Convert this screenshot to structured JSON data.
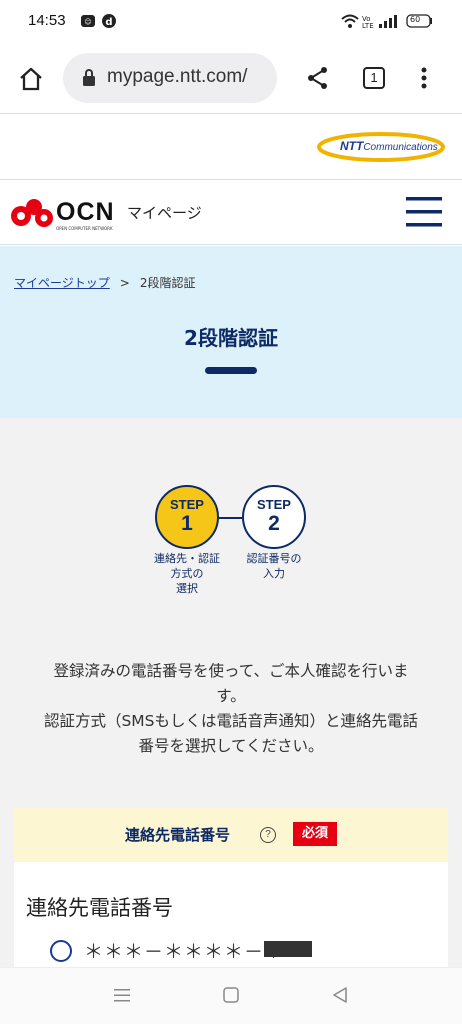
{
  "status_bar": {
    "time": "14:53",
    "battery": "60"
  },
  "browser": {
    "url": "mypage.ntt.com/",
    "tab_count": "1"
  },
  "ntt_header": {
    "brand": "NTT",
    "brand_suffix": "Communications"
  },
  "ocn_header": {
    "brand": "OCN",
    "brand_small": "OPEN COMPUTER NETWORK",
    "title": "マイページ"
  },
  "breadcrumb": {
    "home": "マイページトップ",
    "separator": ">",
    "current": "2段階認証"
  },
  "page_title": "2段階認証",
  "steps": [
    {
      "label": "STEP",
      "number": "1",
      "caption_lines": [
        "連絡先・認証",
        "方式の",
        "選択"
      ],
      "active": true
    },
    {
      "label": "STEP",
      "number": "2",
      "caption_lines": [
        "認証番号の",
        "入力"
      ],
      "active": false
    }
  ],
  "description": {
    "line1": "登録済みの電話番号を使って、ご本人確認を行いま",
    "line2": "す。",
    "line3": "認証方式（SMSもしくは電話音声通知）と連絡先電話",
    "line4": "番号を選択してください。"
  },
  "contact_section": {
    "header": "連絡先電話番号",
    "help": "?",
    "required_badge": "必須",
    "field_label": "連絡先電話番号",
    "phone_masked": "＊＊＊－＊＊＊＊－＊"
  },
  "colors": {
    "accent": "#0d2a66",
    "step_active": "#f5c518",
    "required": "#e60012",
    "hero_bg": "#dcf1f9"
  }
}
